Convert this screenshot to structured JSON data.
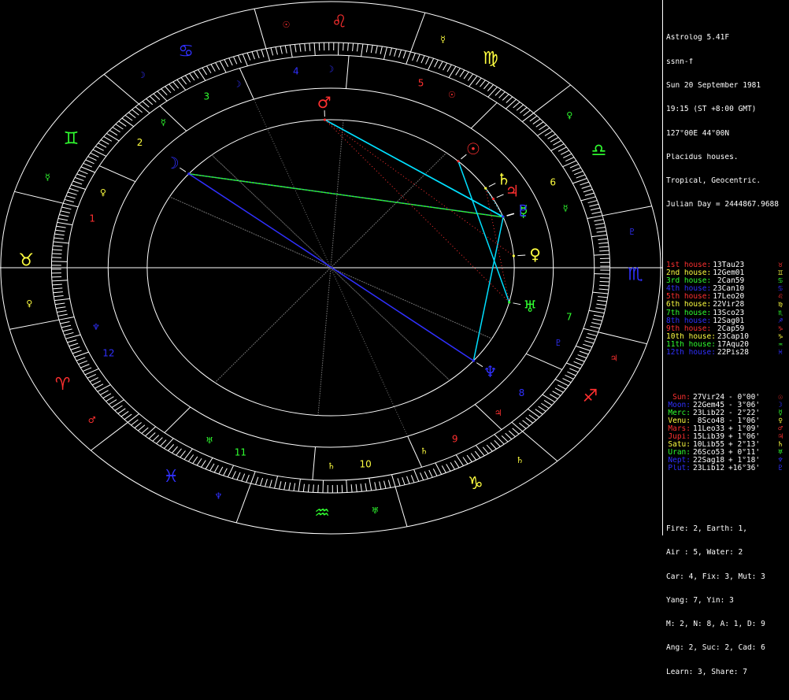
{
  "header": {
    "lines": [
      "Astrolog 5.41F",
      "ssnn-f",
      "Sun 20 September 1981",
      "19:15 (ST +8:00 GMT)",
      "127°00E 44°00N",
      "Placidus houses.",
      "Tropical, Geocentric.",
      "Julian Day = 2444867.9688"
    ]
  },
  "houses": [
    {
      "label": "1st house:",
      "value": "13Tau23",
      "sym": "♉",
      "color": "#ff3030"
    },
    {
      "label": "2nd house:",
      "value": "12Gem01",
      "sym": "♊",
      "color": "#ffff40"
    },
    {
      "label": "3rd house:",
      "value": " 2Can59",
      "sym": "♋",
      "color": "#30ff30"
    },
    {
      "label": "4th house:",
      "value": "23Can10",
      "sym": "♋",
      "color": "#3030ff"
    },
    {
      "label": "5th house:",
      "value": "17Leo20",
      "sym": "♌",
      "color": "#ff3030"
    },
    {
      "label": "6th house:",
      "value": "22Vir28",
      "sym": "♍",
      "color": "#ffff40"
    },
    {
      "label": "7th house:",
      "value": "13Sco23",
      "sym": "♏",
      "color": "#30ff30"
    },
    {
      "label": "8th house:",
      "value": "12Sag01",
      "sym": "♐",
      "color": "#3030ff"
    },
    {
      "label": "9th house:",
      "value": " 2Cap59",
      "sym": "♑",
      "color": "#ff3030"
    },
    {
      "label": "10th house:",
      "value": "23Cap10",
      "sym": "♑",
      "color": "#ffff40"
    },
    {
      "label": "11th house:",
      "value": "17Aqu20",
      "sym": "♒",
      "color": "#30ff30"
    },
    {
      "label": "12th house:",
      "value": "22Pis28",
      "sym": "♓",
      "color": "#3030ff"
    }
  ],
  "planets": [
    {
      "label": "Sun:",
      "value": "27Vir24",
      "vel": "- 0°00'",
      "sym": "☉",
      "color": "#ff3030"
    },
    {
      "label": "Moon:",
      "value": "22Gem45",
      "vel": "- 3°06'",
      "sym": "☽",
      "color": "#3030ff"
    },
    {
      "label": "Merc:",
      "value": "23Lib22",
      "vel": "- 2°22'",
      "sym": "☿",
      "color": "#30ff30"
    },
    {
      "label": "Venu:",
      "value": " 8Sco48",
      "vel": "- 1°06'",
      "sym": "♀",
      "color": "#ffff40"
    },
    {
      "label": "Mars:",
      "value": "11Leo33",
      "vel": "+ 1°09'",
      "sym": "♂",
      "color": "#ff3030"
    },
    {
      "label": "Jupi:",
      "value": "15Lib39",
      "vel": "+ 1°06'",
      "sym": "♃",
      "color": "#ff3030"
    },
    {
      "label": "Satu:",
      "value": "10Lib55",
      "vel": "+ 2°13'",
      "sym": "♄",
      "color": "#ffff40"
    },
    {
      "label": "Uran:",
      "value": "26Sco53",
      "vel": "+ 0°11'",
      "sym": "♅",
      "color": "#30ff30"
    },
    {
      "label": "Nept:",
      "value": "22Sag18",
      "vel": "+ 1°18'",
      "sym": "♆",
      "color": "#3030ff"
    },
    {
      "label": "Plut:",
      "value": "23Lib12",
      "vel": "+16°36'",
      "sym": "♇",
      "color": "#3030ff"
    }
  ],
  "stats": [
    "Fire: 2, Earth: 1,",
    "Air : 5, Water: 2",
    "Car: 4, Fix: 3, Mut: 3",
    "Yang: 7, Yin: 3",
    "M: 2, N: 8, A: 1, D: 9",
    "Ang: 2, Suc: 2, Cad: 6",
    "Learn: 3, Share: 7"
  ],
  "wheel": {
    "ascendant_longitude": 43.38,
    "cusps": [
      43.38,
      72.02,
      92.98,
      113.17,
      137.33,
      172.47,
      223.38,
      252.02,
      272.98,
      293.17,
      317.33,
      352.47
    ],
    "house_numbers": [
      "1",
      "2",
      "3",
      "4",
      "5",
      "6",
      "7",
      "8",
      "9",
      "10",
      "11",
      "12"
    ],
    "house_colors": [
      "#ff3030",
      "#ffff40",
      "#30ff30",
      "#3030ff",
      "#ff3030",
      "#ffff40",
      "#30ff30",
      "#3030ff",
      "#ff3030",
      "#ffff40",
      "#30ff30",
      "#3030ff"
    ],
    "signs": [
      {
        "sym": "♈",
        "ruler": "♂",
        "color": "#ff3030"
      },
      {
        "sym": "♉",
        "ruler": "♀",
        "color": "#ffff40"
      },
      {
        "sym": "♊",
        "ruler": "☿",
        "color": "#30ff30"
      },
      {
        "sym": "♋",
        "ruler": "☽",
        "color": "#3030ff"
      },
      {
        "sym": "♌",
        "ruler": "☉",
        "color": "#ff3030"
      },
      {
        "sym": "♍",
        "ruler": "☿",
        "color": "#ffff40"
      },
      {
        "sym": "♎",
        "ruler": "♀",
        "color": "#30ff30"
      },
      {
        "sym": "♏",
        "ruler": "♇",
        "color": "#3030ff"
      },
      {
        "sym": "♐",
        "ruler": "♃",
        "color": "#ff3030"
      },
      {
        "sym": "♑",
        "ruler": "♄",
        "color": "#ffff40"
      },
      {
        "sym": "♒",
        "ruler": "♅",
        "color": "#30ff30"
      },
      {
        "sym": "♓",
        "ruler": "♆",
        "color": "#3030ff"
      }
    ],
    "house_rulers": [
      {
        "sym": "♀",
        "color": "#ffff40"
      },
      {
        "sym": "☿",
        "color": "#30ff30"
      },
      {
        "sym": "☽",
        "color": "#3030ff"
      },
      {
        "sym": "☽",
        "color": "#3030ff"
      },
      {
        "sym": "☉",
        "color": "#ff3030"
      },
      {
        "sym": "☿",
        "color": "#30ff30"
      },
      {
        "sym": "♇",
        "color": "#3030ff"
      },
      {
        "sym": "♃",
        "color": "#ff3030"
      },
      {
        "sym": "♄",
        "color": "#ffff40"
      },
      {
        "sym": "♄",
        "color": "#ffff40"
      },
      {
        "sym": "♅",
        "color": "#30ff30"
      },
      {
        "sym": "♆",
        "color": "#3030ff"
      }
    ],
    "bodies": [
      {
        "name": "sun",
        "sym": "☉",
        "lon": 177.4,
        "color": "#ff3030"
      },
      {
        "name": "moon",
        "sym": "☽",
        "lon": 82.75,
        "color": "#3030ff"
      },
      {
        "name": "mercury",
        "sym": "☿",
        "lon": 203.37,
        "color": "#30ff30"
      },
      {
        "name": "venus",
        "sym": "♀",
        "lon": 218.8,
        "color": "#ffff40"
      },
      {
        "name": "mars",
        "sym": "♂",
        "lon": 131.55,
        "color": "#ff3030"
      },
      {
        "name": "jupiter",
        "sym": "♃",
        "lon": 195.65,
        "color": "#ff3030"
      },
      {
        "name": "saturn",
        "sym": "♄",
        "lon": 190.92,
        "color": "#ffff40"
      },
      {
        "name": "uranus",
        "sym": "♅",
        "lon": 236.88,
        "color": "#30ff30"
      },
      {
        "name": "neptune",
        "sym": "♆",
        "lon": 262.3,
        "color": "#3030ff"
      },
      {
        "name": "pluto",
        "sym": "♇",
        "lon": 203.2,
        "color": "#3030ff"
      }
    ],
    "aspects": [
      {
        "a": "moon",
        "b": "mercury",
        "color": "#30ff30",
        "style": "solid"
      },
      {
        "a": "moon",
        "b": "neptune",
        "color": "#3030ff",
        "style": "solid"
      },
      {
        "a": "moon",
        "b": "pluto",
        "color": "#3030ff",
        "style": "dotted"
      },
      {
        "a": "mars",
        "b": "pluto",
        "color": "#00e0ff",
        "style": "solid"
      },
      {
        "a": "mars",
        "b": "mercury",
        "color": "#00e0ff",
        "style": "solid"
      },
      {
        "a": "mercury",
        "b": "neptune",
        "color": "#00e0ff",
        "style": "solid"
      },
      {
        "a": "mars",
        "b": "uranus",
        "color": "#ff3030",
        "style": "dotted"
      },
      {
        "a": "venus",
        "b": "mars",
        "color": "#ff3030",
        "style": "dotted"
      },
      {
        "a": "sun",
        "b": "uranus",
        "color": "#00e0ff",
        "style": "solid"
      },
      {
        "a": "saturn",
        "b": "uranus",
        "color": "#ff3030",
        "style": "dotted"
      },
      {
        "a": "mercury",
        "b": "saturn",
        "color": "#00e0ff",
        "style": "dotted"
      }
    ]
  }
}
